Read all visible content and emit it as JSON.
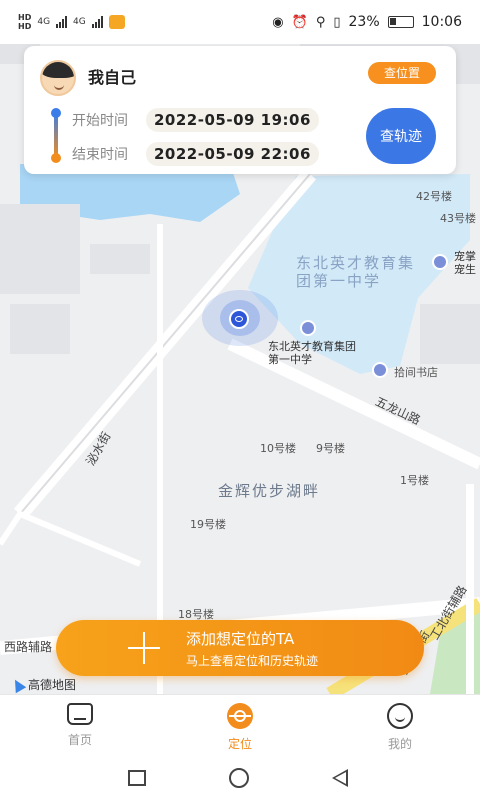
{
  "status_bar": {
    "network_labels": [
      "HD",
      "HD",
      "4G",
      "4G"
    ],
    "battery": "23%",
    "time": "10:06"
  },
  "card": {
    "user_name": "我自己",
    "check_position_button": "查位置",
    "start_label": "开始时间",
    "start_time": "2022-05-09 19:06",
    "end_label": "结束时间",
    "end_time": "2022-05-09 22:06",
    "track_button": "查轨迹"
  },
  "map": {
    "labels": {
      "school_area": "东北英才教育集团第一中学",
      "school_poi": "东北英才教育集团第一中学",
      "bookstore": "拾间书店",
      "road_wulongshan": "五龙山路",
      "road_bishui": "泌水街",
      "compound": "金辉优步湖畔",
      "bldg_42": "42号楼",
      "bldg_43": "43号楼",
      "bldg_10": "10号楼",
      "bldg_9": "9号楼",
      "bldg_1": "1号楼",
      "bldg_19": "19号楼",
      "bldg_18": "18号楼",
      "poi_right": "宠掌宠生",
      "road_west": "西路辅路",
      "road_north_aux": "工北街辅路",
      "road_north": "皇工北街"
    },
    "logo": "高德地图"
  },
  "add_banner": {
    "title": "添加想定位的TA",
    "subtitle": "马上查看定位和历史轨迹"
  },
  "tabbar": {
    "tabs": [
      {
        "label": "首页",
        "icon": "home-icon",
        "active": false
      },
      {
        "label": "定位",
        "icon": "location-icon",
        "active": true
      },
      {
        "label": "我的",
        "icon": "smile-icon",
        "active": false
      }
    ]
  },
  "colors": {
    "accent_orange": "#f28c1c",
    "accent_blue": "#3c77e6",
    "water_blue": "#a9d6f5",
    "school_fill": "#d2e9f8"
  }
}
